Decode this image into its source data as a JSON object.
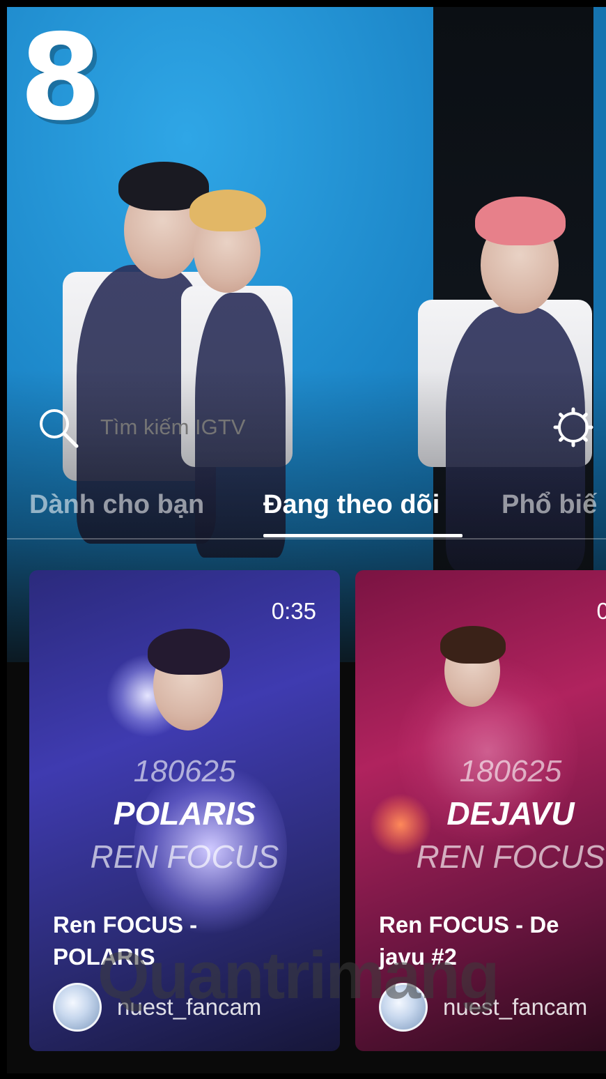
{
  "search": {
    "placeholder": "Tìm kiếm IGTV"
  },
  "tabs": [
    {
      "label": "Dành cho bạn",
      "active": false
    },
    {
      "label": "Đang theo dõi",
      "active": true
    },
    {
      "label": "Phổ biế",
      "active": false
    }
  ],
  "hero": {
    "digit": "8"
  },
  "cards": [
    {
      "duration": "0:35",
      "overlay_date": "180625",
      "overlay_title": "POLARIS",
      "overlay_sub": "REN FOCUS",
      "title": "Ren FOCUS - POLARIS",
      "username": "nuest_fancam"
    },
    {
      "duration": "0:",
      "overlay_date": "180625",
      "overlay_title": "DEJAVU",
      "overlay_sub": "REN FOCUS",
      "title": "Ren FOCUS - De javu #2",
      "username": "nuest_fancam"
    }
  ],
  "watermark": "Quantrimang",
  "icons": {
    "search": "search-icon",
    "settings": "gear-icon"
  },
  "colors": {
    "accent": "#ffffff",
    "hero_blue": "#1c86c8",
    "card1": "#3f3bb0",
    "card2": "#b0235e"
  }
}
